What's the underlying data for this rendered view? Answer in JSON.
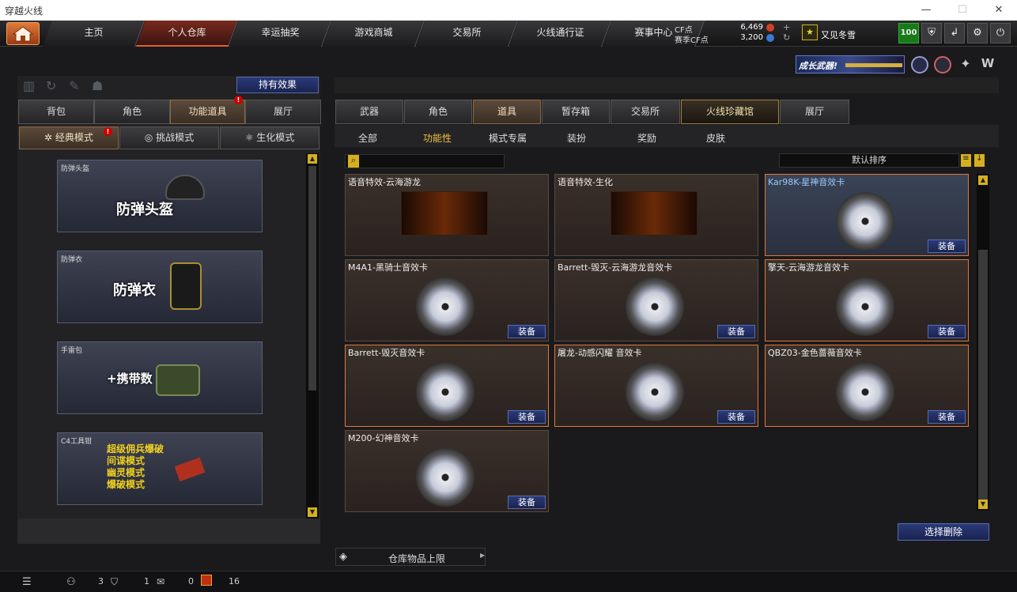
{
  "window": {
    "title": "穿越火线"
  },
  "nav": {
    "tabs": [
      "主页",
      "个人仓库",
      "幸运抽奖",
      "游戏商城",
      "交易所",
      "火线通行证",
      "赛事中心"
    ],
    "active": 1
  },
  "currency": {
    "cf_label": "CF点",
    "cf_value": "6,469",
    "match_label": "赛季CF点",
    "match_value": "3,200"
  },
  "user": {
    "name": "又见冬雪",
    "level": "100"
  },
  "banner": {
    "text": "成长武器!"
  },
  "left": {
    "effects_button": "持有效果",
    "tabs": [
      "背包",
      "角色",
      "功能道具",
      "展厅"
    ],
    "active_tab": 2,
    "modes": [
      "经典模式",
      "挑战模式",
      "生化模式"
    ],
    "active_mode": 0,
    "cards": [
      {
        "label": "防弹头盔",
        "big": "防弹头盔"
      },
      {
        "label": "防弹衣",
        "big": "防弹衣"
      },
      {
        "label": "手雷包",
        "big": "+携带数"
      },
      {
        "label": "C4工具钳",
        "lines": [
          "超级佣兵爆破",
          "间谍模式",
          "幽灵模式",
          "爆破模式"
        ]
      }
    ]
  },
  "right": {
    "tabs": [
      "武器",
      "角色",
      "道具",
      "暂存箱",
      "交易所",
      "火线珍藏馆",
      "展厅"
    ],
    "active_tab": 2,
    "subtabs": [
      "全部",
      "功能性",
      "模式专属",
      "装扮",
      "奖励",
      "皮肤"
    ],
    "active_subtab": 1,
    "search_placeholder": "",
    "sort_label": "默认排序",
    "equip_label": "装备",
    "items": [
      {
        "name": "语音特效-云海游龙",
        "kind": "banner",
        "equip": false
      },
      {
        "name": "语音特效-生化",
        "kind": "banner",
        "equip": false
      },
      {
        "name": "Kar98K-星神音效卡",
        "kind": "disc",
        "equip": true
      },
      {
        "name": "M4A1-黑骑士音效卡",
        "kind": "disc",
        "equip": true
      },
      {
        "name": "Barrett-毁灭-云海游龙音效卡",
        "kind": "disc",
        "equip": true
      },
      {
        "name": "擎天-云海游龙音效卡",
        "kind": "disc",
        "equip": true
      },
      {
        "name": "Barrett-毁灭音效卡",
        "kind": "disc",
        "equip": true
      },
      {
        "name": "屠龙-动感闪耀 音效卡",
        "kind": "disc",
        "equip": true
      },
      {
        "name": "QBZ03-金色蔷薇音效卡",
        "kind": "disc",
        "equip": true
      },
      {
        "name": "M200-幻神音效卡",
        "kind": "disc",
        "equip": true
      }
    ],
    "delete_button": "选择删除",
    "capacity_button": "仓库物品上限"
  },
  "status": {
    "friends": "3",
    "clan": "1",
    "messages": "0",
    "gifts": "16"
  }
}
